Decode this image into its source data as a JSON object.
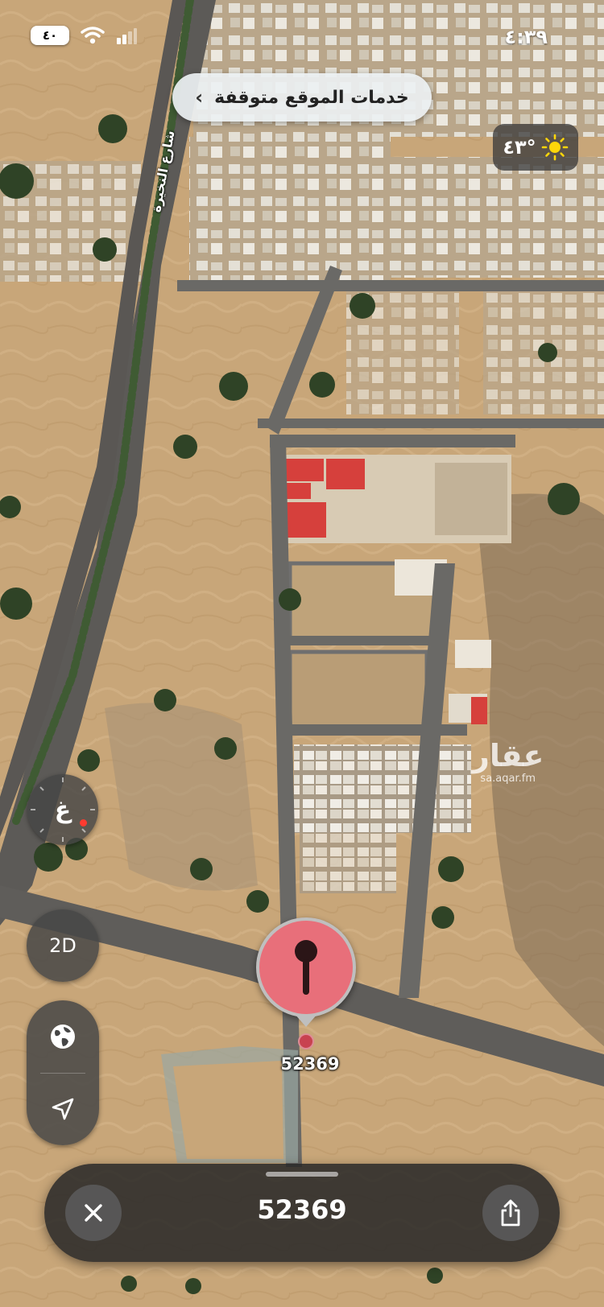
{
  "status_bar": {
    "time": "٤:٣٩",
    "battery": "٤٠"
  },
  "location_banner": {
    "label": "خدمات الموقع متوقفة"
  },
  "weather": {
    "temperature": "٤٣°",
    "icon": "sun-icon"
  },
  "map": {
    "street_name": "شارع النخيرة",
    "watermark_logo": "عقار",
    "watermark_url": "sa.aqar.fm",
    "pin_label": "52369"
  },
  "compass": {
    "heading_letter": "غ"
  },
  "controls": {
    "view_mode_label": "2D",
    "globe_icon": "globe-icon",
    "locate_icon": "location-arrow-icon"
  },
  "bottom_sheet": {
    "title": "52369",
    "close_icon": "close-icon",
    "share_icon": "share-icon"
  },
  "colors": {
    "pin_fill": "#e86f7a",
    "pin_dot": "#c84250",
    "north_marker": "#ff3b30",
    "sun": "#ffd60a"
  }
}
